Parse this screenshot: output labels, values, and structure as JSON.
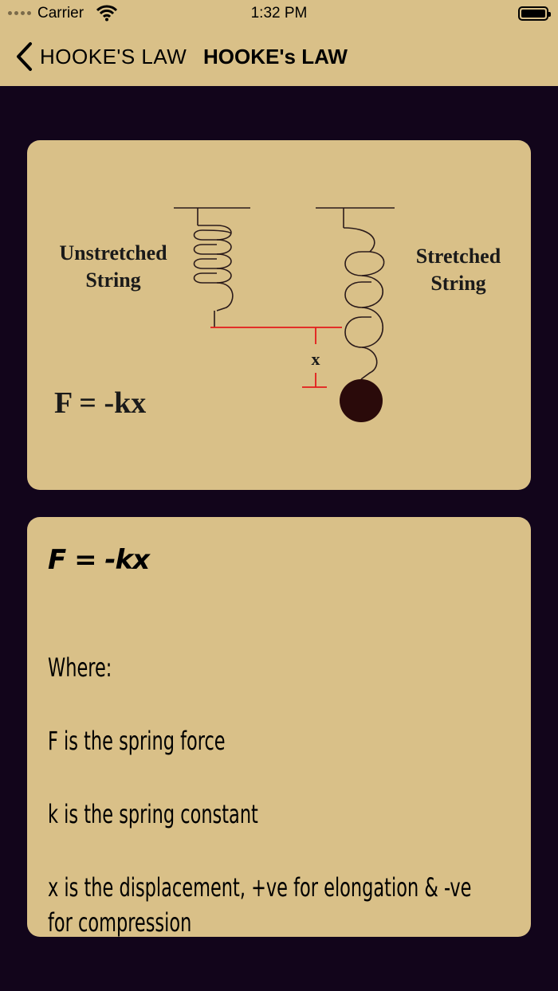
{
  "status_bar": {
    "carrier": "Carrier",
    "time": "1:32 PM"
  },
  "nav": {
    "back_label": "HOOKE'S LAW",
    "title": "HOOKE's LAW"
  },
  "diagram": {
    "unstretched_label_line1": "Unstretched",
    "unstretched_label_line2": "String",
    "stretched_label_line1": "Stretched",
    "stretched_label_line2": "String",
    "displacement_label": "x",
    "formula": "F = -kx"
  },
  "explanation": {
    "formula": "F = -kx",
    "where": "Where:",
    "f_line": "F is the spring force",
    "k_line": "k is the spring constant",
    "x_line_1": "x is the displacement, +ve for elongation & -ve",
    "x_line_2": "for compression"
  },
  "colors": {
    "background": "#12051b",
    "card": "#d9c088",
    "accent_red": "#e31b1b",
    "mass": "#2a0a0a"
  }
}
